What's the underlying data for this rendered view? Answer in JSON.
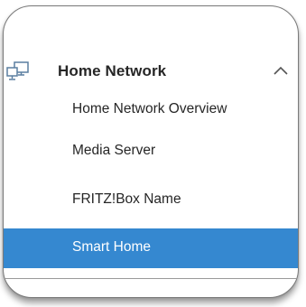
{
  "menu": {
    "header": {
      "label": "Home Network",
      "icon": "network-computers-icon",
      "expanded": true
    },
    "items": [
      {
        "label": "Home Network Overview",
        "active": false
      },
      {
        "label": "Media Server",
        "active": false
      },
      {
        "label": "FRITZ!Box Name",
        "active": false
      },
      {
        "label": "Smart Home",
        "active": true
      }
    ]
  },
  "colors": {
    "active_background": "#3588d0",
    "active_text": "#ffffff",
    "text": "#262626",
    "icon": "#5a7fa0"
  }
}
